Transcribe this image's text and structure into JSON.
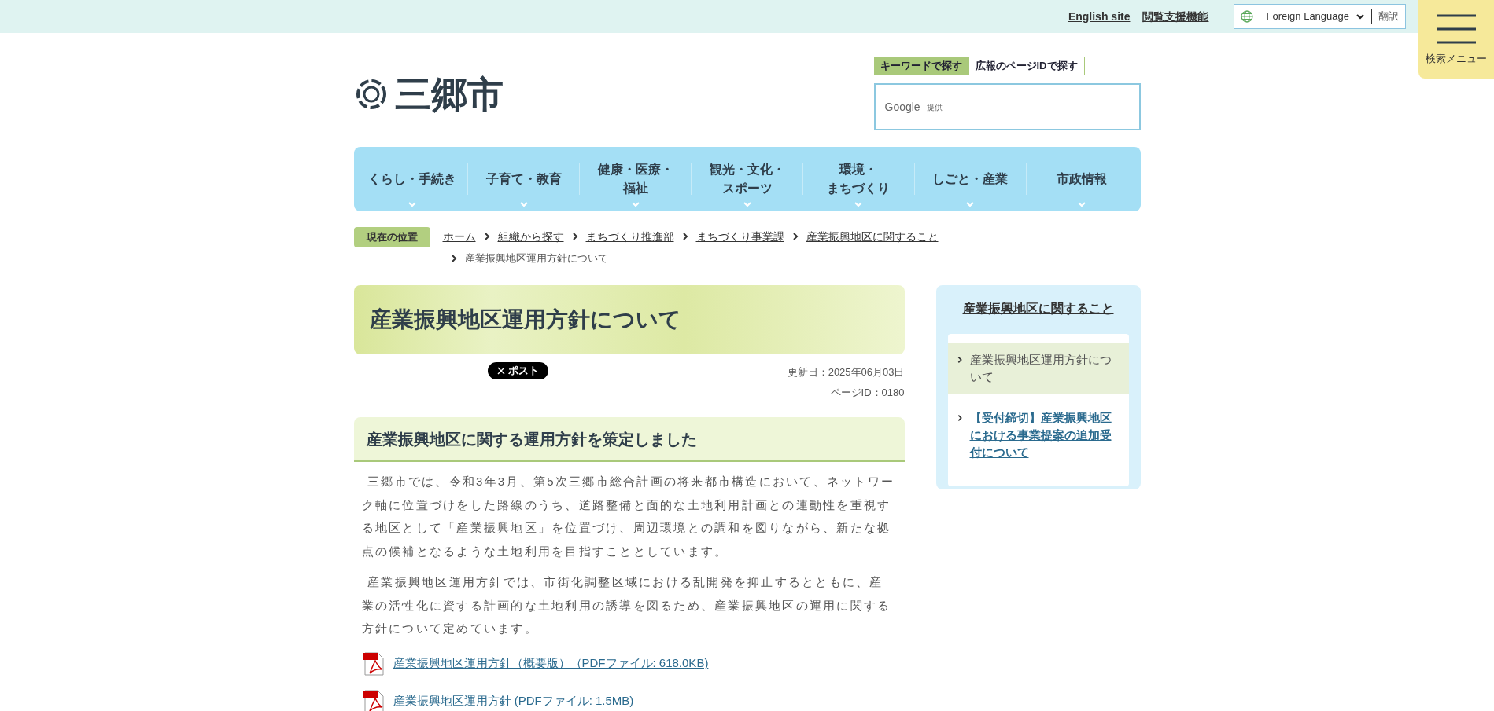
{
  "top_bar": {
    "links": [
      "English site",
      "閲覧支援機能"
    ],
    "language_select": {
      "value": "Foreign Language"
    },
    "translate_button": "翻訳"
  },
  "menu_button": {
    "label": "検索メニュー"
  },
  "logo": {
    "text": "三郷市"
  },
  "search": {
    "tabs": [
      {
        "label": "キーワードで探す",
        "selected": true
      },
      {
        "label": "広報のページIDで探す",
        "selected": false
      }
    ],
    "provider": "Google",
    "provider_note": "提供"
  },
  "nav": [
    {
      "lines": [
        "くらし・手続き"
      ]
    },
    {
      "lines": [
        "子育て・教育"
      ]
    },
    {
      "lines": [
        "健康・医療・",
        "福祉"
      ]
    },
    {
      "lines": [
        "観光・文化・",
        "スポーツ"
      ]
    },
    {
      "lines": [
        "環境・",
        "まちづくり"
      ]
    },
    {
      "lines": [
        "しごと・産業"
      ]
    },
    {
      "lines": [
        "市政情報"
      ]
    }
  ],
  "breadcrumb": {
    "label": "現在の位置",
    "items": [
      {
        "text": "ホーム",
        "link": true
      },
      {
        "text": "組織から探す",
        "link": true
      },
      {
        "text": "まちづくり推進部",
        "link": true
      },
      {
        "text": "まちづくり事業課",
        "link": true
      },
      {
        "text": "産業振興地区に関すること",
        "link": true
      },
      {
        "text": "産業振興地区運用方針について",
        "link": false
      }
    ]
  },
  "page_title": "産業振興地区運用方針について",
  "share_button": "ポスト",
  "updated": "更新日：2025年06月03日",
  "page_id": "ページID：0180",
  "section_heading": "産業振興地区に関する運用方針を策定しました",
  "paragraphs": [
    "三郷市では、令和3年3月、第5次三郷市総合計画の将来都市構造において、ネットワーク軸に位置づけをした路線のうち、道路整備と面的な土地利用計画との連動性を重視する地区として「産業振興地区」を位置づけ、周辺環境との調和を図りながら、新たな拠点の候補となるような土地利用を目指すこととしています。",
    "産業振興地区運用方針では、市街化調整区域における乱開発を抑止するとともに、産業の活性化に資する計画的な土地利用の誘導を図るため、産業振興地区の運用に関する方針について定めています。"
  ],
  "files": [
    {
      "label": "産業振興地区運用方針（概要版）（PDFファイル: 618.0KB)"
    },
    {
      "label": "産業振興地区運用方針 (PDFファイル: 1.5MB)"
    }
  ],
  "sidebar": {
    "title": "産業振興地区に関すること",
    "items": [
      {
        "label": "産業振興地区運用方針について",
        "selected": true
      },
      {
        "label": "【受付締切】産業振興地区における事業提案の追加受付について",
        "selected": false
      }
    ]
  }
}
